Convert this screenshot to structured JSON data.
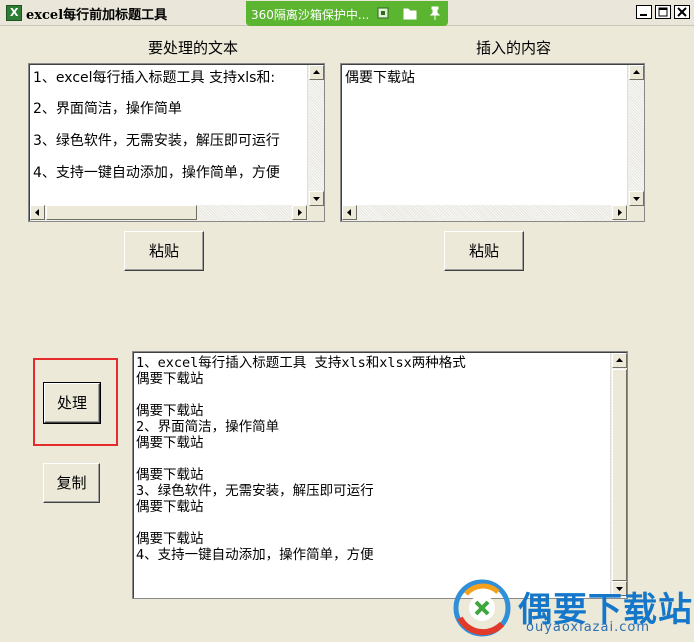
{
  "window": {
    "title": "excel每行前加标题工具",
    "sandbox_notice": "360隔离沙箱保护中..."
  },
  "left_panel": {
    "label": "要处理的文本",
    "lines": [
      "1、excel每行插入标题工具 支持xls和:",
      "2、界面简洁，操作简单",
      "3、绿色软件，无需安装，解压即可运行",
      "4、支持一键自动添加，操作简单，方便"
    ],
    "paste_button": "粘贴"
  },
  "right_panel": {
    "label": "插入的内容",
    "value": "偶要下载站",
    "paste_button": "粘贴"
  },
  "actions": {
    "process_button": "处理",
    "copy_button": "复制"
  },
  "output": {
    "lines": [
      "1、excel每行插入标题工具 支持xls和xlsx两种格式",
      "偶要下载站",
      "",
      "偶要下载站",
      "2、界面简洁，操作简单",
      "偶要下载站",
      "",
      "偶要下载站",
      "3、绿色软件，无需安装，解压即可运行",
      "偶要下载站",
      "",
      "偶要下载站",
      "4、支持一键自动添加，操作简单，方便"
    ]
  },
  "watermark": {
    "brand": "偶要下载站",
    "url": "ouyaoxiazai.com"
  },
  "icons": {
    "app": "excel-app-icon",
    "sandbox": [
      "sandbox-shield-icon",
      "folder-icon",
      "pin-icon"
    ],
    "window": [
      "minimize-icon",
      "maximize-icon",
      "close-icon"
    ]
  },
  "colors": {
    "sandbox_green": "#5cb531",
    "highlight_red": "#e52b2b",
    "brand_blue": "#1577c9"
  }
}
